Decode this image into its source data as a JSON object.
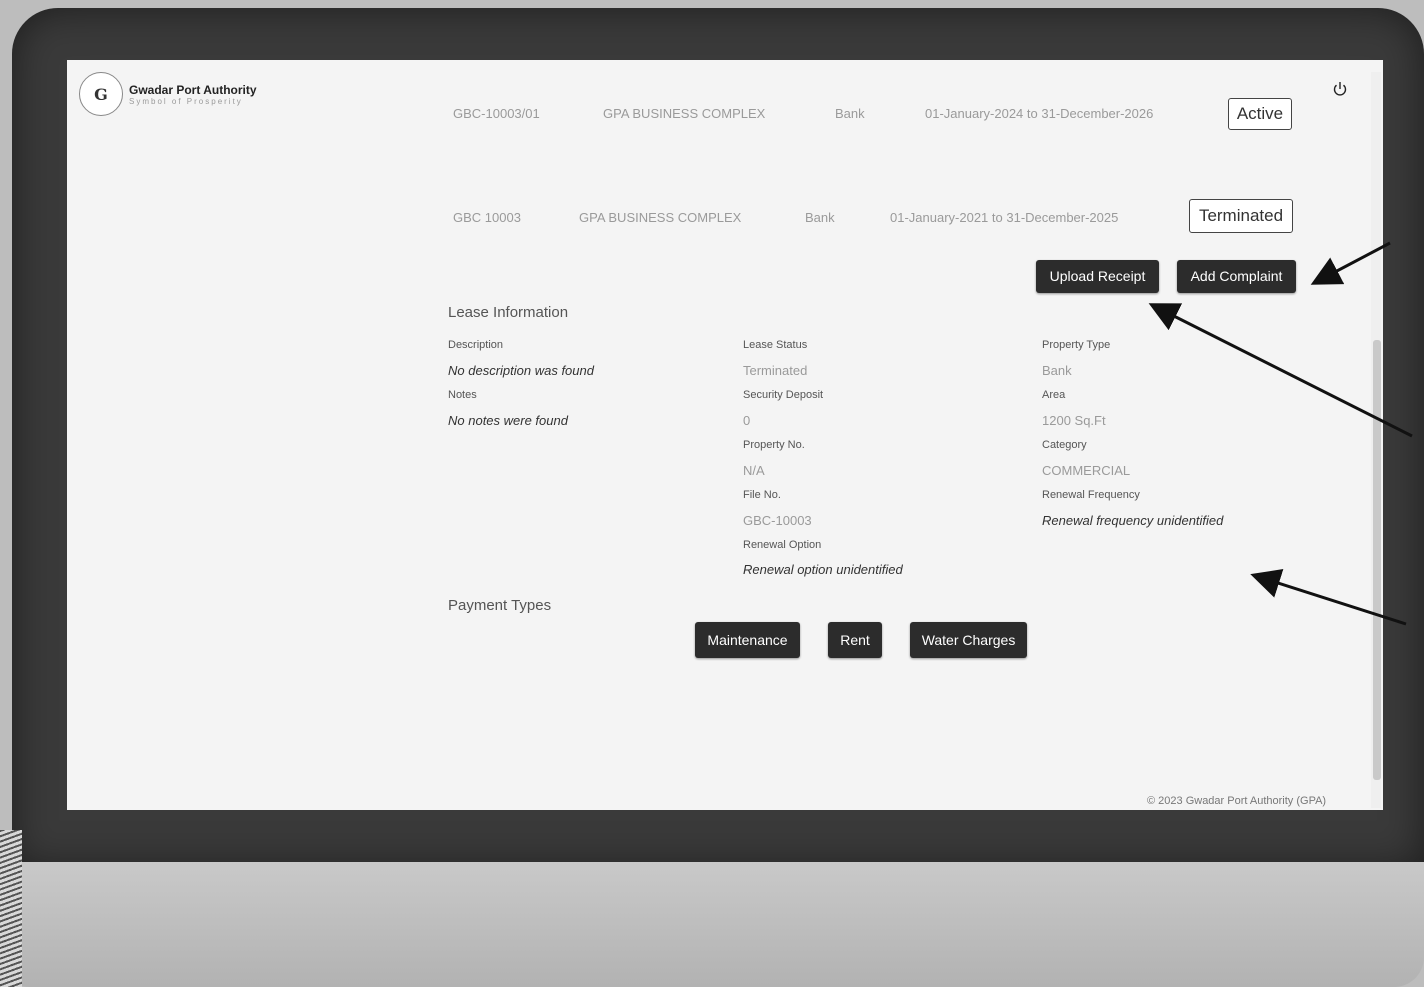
{
  "header": {
    "logo_mark": "G",
    "logo_title": "Gwadar Port Authority",
    "logo_subtitle": "Symbol of Prosperity"
  },
  "leases": [
    {
      "file_no": "GBC-10003/01",
      "property": "GPA BUSINESS COMPLEX",
      "type": "Bank",
      "period": "01-January-2024 to 31-December-2026",
      "status": "Active"
    },
    {
      "file_no": "GBC 10003",
      "property": "GPA BUSINESS COMPLEX",
      "type": "Bank",
      "period": "01-January-2021 to 31-December-2025",
      "status": "Terminated"
    }
  ],
  "actions": {
    "upload_receipt": "Upload Receipt",
    "add_complaint": "Add Complaint"
  },
  "lease_info": {
    "title": "Lease Information",
    "description_label": "Description",
    "description_value": "No description was found",
    "notes_label": "Notes",
    "notes_value": "No notes were found",
    "lease_status_label": "Lease Status",
    "lease_status_value": "Terminated",
    "security_deposit_label": "Security Deposit",
    "security_deposit_value": "0",
    "property_no_label": "Property No.",
    "property_no_value": "N/A",
    "file_no_label": "File No.",
    "file_no_value": "GBC-10003",
    "renewal_option_label": "Renewal Option",
    "renewal_option_value": "Renewal option unidentified",
    "property_type_label": "Property Type",
    "property_type_value": "Bank",
    "area_label": "Area",
    "area_value": "1200 Sq.Ft",
    "category_label": "Category",
    "category_value": "COMMERCIAL",
    "renewal_frequency_label": "Renewal Frequency",
    "renewal_frequency_value": "Renewal frequency unidentified"
  },
  "payment_types": {
    "title": "Payment Types",
    "maintenance": "Maintenance",
    "rent": "Rent",
    "water_charges": "Water Charges"
  },
  "footer": {
    "copyright": "© 2023 Gwadar Port Authority (GPA)"
  }
}
